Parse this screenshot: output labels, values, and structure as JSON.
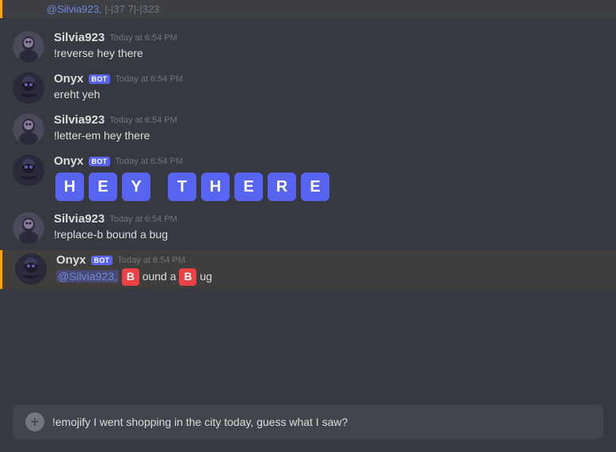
{
  "notification": {
    "text": "[@Silvia923, |-|37 7|-|323",
    "mention": "@Silvia923,"
  },
  "messages": [
    {
      "id": "msg1",
      "user": "Silvia923",
      "userType": "human",
      "timestamp": "Today at 6:54 PM",
      "text": "!reverse hey there"
    },
    {
      "id": "msg2",
      "user": "Onyx",
      "userType": "bot",
      "timestamp": "Today at 6:54 PM",
      "text": "ereht yeh"
    },
    {
      "id": "msg3",
      "user": "Silvia923",
      "userType": "human",
      "timestamp": "Today at 6:54 PM",
      "text": "!letter-em hey there"
    },
    {
      "id": "msg4",
      "user": "Onyx",
      "userType": "bot",
      "timestamp": "Today at 6:54 PM",
      "letters": [
        "H",
        "E",
        "Y",
        "T",
        "H",
        "E",
        "R",
        "E"
      ]
    },
    {
      "id": "msg5",
      "user": "Silvia923",
      "userType": "human",
      "timestamp": "Today at 6:54 PM",
      "text": "!replace-b bound a bug"
    },
    {
      "id": "msg6",
      "user": "Onyx",
      "userType": "bot",
      "timestamp": "Today at 6:54 PM",
      "highlighted": true,
      "mention": "@Silvia923,",
      "replacedText": "ound a",
      "suffix": "ug",
      "hasReplace": true
    }
  ],
  "input": {
    "placeholder": "!emojify I went shopping in the city today, guess what I saw?",
    "addButton": "+"
  },
  "bot_badge": "BOT"
}
